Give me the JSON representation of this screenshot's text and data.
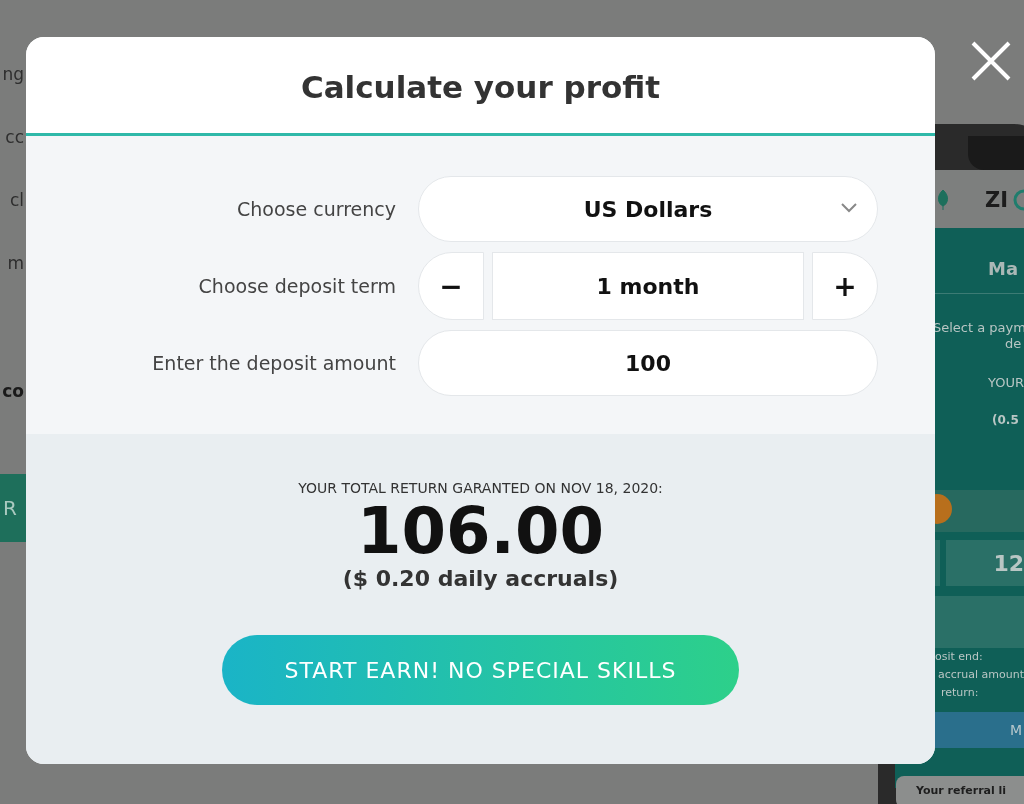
{
  "background": {
    "left_fragments": [
      {
        "text": "ng",
        "bold": false
      },
      {
        "text": "cc",
        "bold": false
      },
      {
        "text": "cl",
        "bold": false
      },
      {
        "text": "m",
        "bold": false
      },
      {
        "text": "co",
        "bold": true
      }
    ],
    "left_button": "R",
    "phone": {
      "logo": "ZI",
      "heading": "Ma",
      "intro": [
        "Select a paym",
        "de"
      ],
      "total_label": "YOUR",
      "rate": "(0.5",
      "amount": "12",
      "details": [
        "osit end:",
        "accrual amount",
        "return:"
      ],
      "button": "M",
      "referral": "Your referral li"
    }
  },
  "modal": {
    "title": "Calculate your profit",
    "currency": {
      "label": "Choose currency",
      "value": "US Dollars"
    },
    "term": {
      "label": "Choose deposit term",
      "minus": "−",
      "value": "1 month",
      "plus": "+"
    },
    "amount": {
      "label": "Enter the deposit amount",
      "value": "100"
    },
    "result": {
      "caption": "YOUR TOTAL RETURN GARANTED ON NOV 18, 2020:",
      "total": "106.00",
      "daily": "($ 0.20 daily accruals)"
    },
    "cta": "START EARN! NO SPECIAL SKILLS"
  }
}
